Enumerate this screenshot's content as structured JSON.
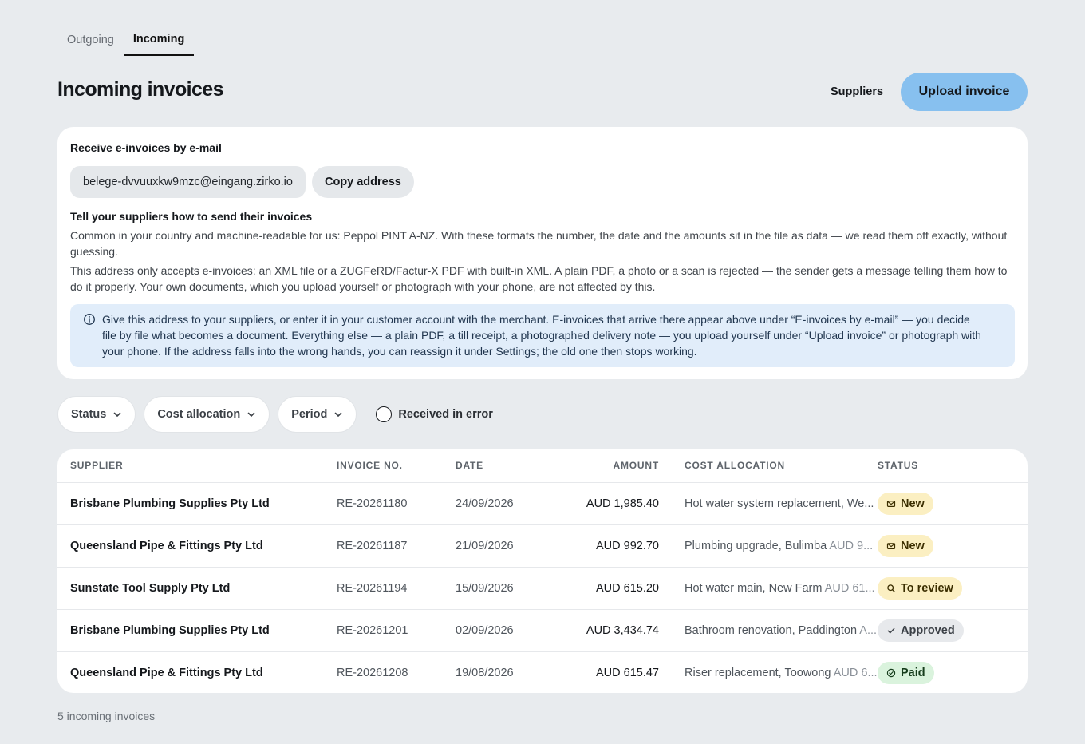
{
  "tabs": [
    {
      "label": "Outgoing",
      "active": false
    },
    {
      "label": "Incoming",
      "active": true
    }
  ],
  "header": {
    "title": "Incoming invoices",
    "suppliers_label": "Suppliers",
    "upload_label": "Upload invoice"
  },
  "colors": {
    "accent": "#87c0ef",
    "info_bg": "#e1edfa",
    "badge_new": "#fbefc2",
    "badge_paid": "#daf3dd",
    "badge_approved": "#e7e9ec"
  },
  "email_card": {
    "heading": "Receive e-invoices by e-mail",
    "address": "belege-dvvuuxkw9mzc@eingang.zirko.io",
    "copy_label": "Copy address",
    "sub_heading": "Tell your suppliers how to send their invoices",
    "para1": "Common in your country and machine-readable for us: Peppol PINT A-NZ. With these formats the number, the date and the amounts sit in the file as data — we read them off exactly, without guessing.",
    "para2": "This address only accepts e-invoices: an XML file or a ZUGFeRD/Factur-X PDF with built-in XML. A plain PDF, a photo or a scan is rejected — the sender gets a message telling them how to do it properly. Your own documents, which you upload yourself or photograph with your phone, are not affected by this.",
    "info_icon": "info-circle-icon",
    "info_text": "Give this address to your suppliers, or enter it in your customer account with the merchant. E-invoices that arrive there appear above under “E-invoices by e-mail” — you decide file by file what becomes a document. Everything else — a plain PDF, a till receipt, a photographed delivery note — you upload yourself under “Upload invoice” or photograph with your phone. If the address falls into the wrong hands, you can reassign it under Settings; the old one then stops working."
  },
  "filters": {
    "status": "Status",
    "cost_allocation": "Cost allocation",
    "period": "Period",
    "received_in_error": "Received in error",
    "received_in_error_checked": false
  },
  "table": {
    "columns": [
      "SUPPLIER",
      "INVOICE NO.",
      "DATE",
      "AMOUNT",
      "COST ALLOCATION",
      "STATUS"
    ],
    "rows": [
      {
        "supplier": "Brisbane Plumbing Supplies Pty Ltd",
        "invoice": "RE-20261180",
        "date": "24/09/2026",
        "amount": "AUD 1,985.40",
        "cost": "Hot water system replacement, We...",
        "cost_amount": "",
        "status": "New",
        "status_icon": "mail-icon"
      },
      {
        "supplier": "Queensland Pipe & Fittings Pty Ltd",
        "invoice": "RE-20261187",
        "date": "21/09/2026",
        "amount": "AUD 992.70",
        "cost": "Plumbing upgrade, Bulimba",
        "cost_amount": "AUD 9...",
        "status": "New",
        "status_icon": "mail-icon"
      },
      {
        "supplier": "Sunstate Tool Supply Pty Ltd",
        "invoice": "RE-20261194",
        "date": "15/09/2026",
        "amount": "AUD 615.20",
        "cost": "Hot water main, New Farm",
        "cost_amount": "AUD 61...",
        "status": "To review",
        "status_icon": "search-icon"
      },
      {
        "supplier": "Brisbane Plumbing Supplies Pty Ltd",
        "invoice": "RE-20261201",
        "date": "02/09/2026",
        "amount": "AUD 3,434.74",
        "cost": "Bathroom renovation, Paddington",
        "cost_amount": "A...",
        "status": "Approved",
        "status_icon": "check-icon"
      },
      {
        "supplier": "Queensland Pipe & Fittings Pty Ltd",
        "invoice": "RE-20261208",
        "date": "19/08/2026",
        "amount": "AUD 615.47",
        "cost": "Riser replacement, Toowong",
        "cost_amount": "AUD 6...",
        "status": "Paid",
        "status_icon": "check-circle-icon"
      }
    ]
  },
  "footer": {
    "count": "5 incoming invoices"
  }
}
